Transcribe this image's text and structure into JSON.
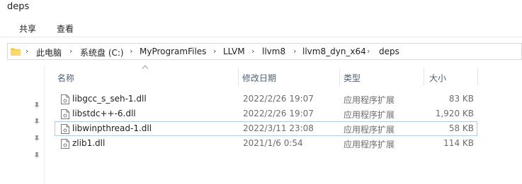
{
  "window": {
    "title": "deps"
  },
  "ribbon": {
    "tabs": [
      "共享",
      "查看"
    ]
  },
  "address_bar": {
    "crumbs": [
      "此电脑",
      "系统盘 (C:)",
      "MyProgramFiles",
      "LLVM",
      "llvm8",
      "llvm8_dyn_x64",
      "deps"
    ]
  },
  "columns": {
    "name": "名称",
    "date": "修改日期",
    "type": "类型",
    "size": "大小"
  },
  "files": [
    {
      "name": "libgcc_s_seh-1.dll",
      "date": "2022/2/26 19:07",
      "type": "应用程序扩展",
      "size": "83 KB",
      "selected": false
    },
    {
      "name": "libstdc++-6.dll",
      "date": "2022/2/26 19:07",
      "type": "应用程序扩展",
      "size": "1,920 KB",
      "selected": false
    },
    {
      "name": "libwinpthread-1.dll",
      "date": "2022/3/11 23:08",
      "type": "应用程序扩展",
      "size": "58 KB",
      "selected": true
    },
    {
      "name": "zlib1.dll",
      "date": "2021/1/6 0:54",
      "type": "应用程序扩展",
      "size": "114 KB",
      "selected": false
    }
  ],
  "colors": {
    "header_text": "#4c607a",
    "selection_border": "#99d1ff",
    "folder": "#f5c542"
  },
  "icons": {
    "pin": "pin-icon",
    "folder": "folder-icon",
    "file": "dll-file-icon",
    "sort": "sort-up-icon"
  }
}
